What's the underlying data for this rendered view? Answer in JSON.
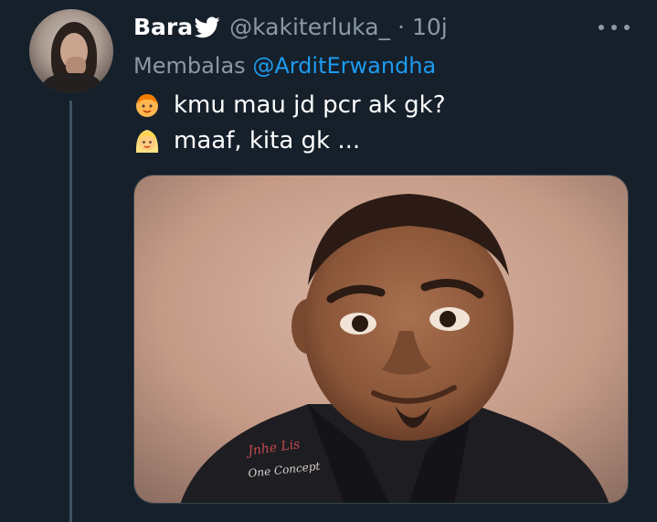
{
  "user": {
    "display_name": "Bara",
    "handle": "@kakiterluka_",
    "separator": "·",
    "time": "10j",
    "verified_icon": "twitter-bird-icon"
  },
  "reply": {
    "label": "Membalas",
    "mention": "@ArditErwandha"
  },
  "tweet": {
    "line1": {
      "emoji": "boy-face-emoji",
      "text": "kmu mau jd pcr ak gk?"
    },
    "line2": {
      "emoji": "blonde-girl-emoji",
      "text": "maaf, kita gk ..."
    }
  },
  "media": {
    "description_icon": "photo-image",
    "shirt_text_1": "Jnhe Lis",
    "shirt_text_2": "One Concept"
  },
  "colors": {
    "background": "#15202b",
    "muted": "#8b98a5",
    "link": "#1d9bf0",
    "thread_line": "#3d5466"
  }
}
